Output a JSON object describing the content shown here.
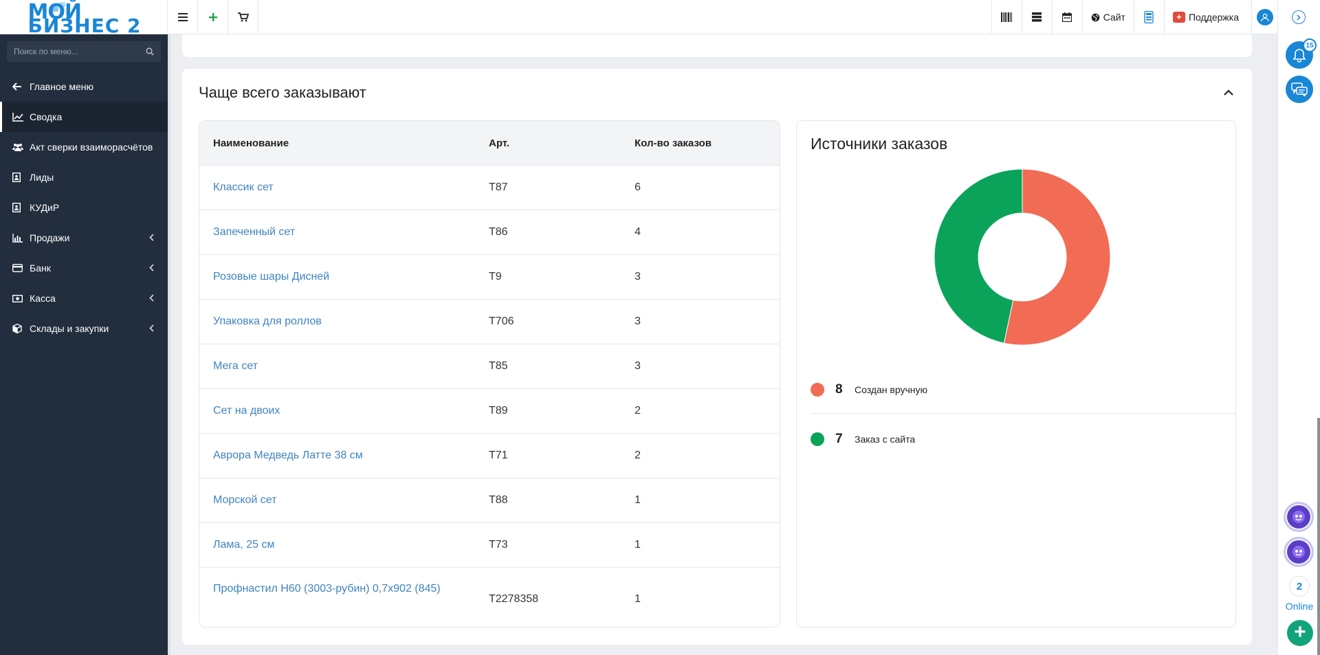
{
  "header": {
    "logo_line1": "МОЙ",
    "logo_line2": "БИЗНЕС 2",
    "site_label": "Сайт",
    "support_label": "Поддержка"
  },
  "sidebar": {
    "search_placeholder": "Поиск по меню...",
    "items": [
      {
        "label": "Главное меню",
        "icon": "arrow-left-icon",
        "active": false,
        "has_submenu": false
      },
      {
        "label": "Сводка",
        "icon": "chart-line-icon",
        "active": true,
        "has_submenu": false
      },
      {
        "label": "Акт сверки взаиморасчётов",
        "icon": "users-icon",
        "active": false,
        "has_submenu": false
      },
      {
        "label": "Лиды",
        "icon": "contact-card-icon",
        "active": false,
        "has_submenu": false
      },
      {
        "label": "КУДиР",
        "icon": "contact-card-icon",
        "active": false,
        "has_submenu": false
      },
      {
        "label": "Продажи",
        "icon": "bar-chart-icon",
        "active": false,
        "has_submenu": true
      },
      {
        "label": "Банк",
        "icon": "credit-card-icon",
        "active": false,
        "has_submenu": true
      },
      {
        "label": "Касса",
        "icon": "money-icon",
        "active": false,
        "has_submenu": true
      },
      {
        "label": "Склады и закупки",
        "icon": "box-icon",
        "active": false,
        "has_submenu": true
      }
    ]
  },
  "section": {
    "title": "Чаще всего заказывают"
  },
  "table": {
    "columns": [
      "Наименование",
      "Арт.",
      "Кол-во заказов"
    ],
    "rows": [
      {
        "name": "Классик сет",
        "sku": "T87",
        "orders": "6"
      },
      {
        "name": "Запеченный сет",
        "sku": "T86",
        "orders": "4"
      },
      {
        "name": "Розовые шары Дисней",
        "sku": "T9",
        "orders": "3"
      },
      {
        "name": "Упаковка для роллов",
        "sku": "T706",
        "orders": "3"
      },
      {
        "name": "Мега сет",
        "sku": "T85",
        "orders": "3"
      },
      {
        "name": "Сет на двоих",
        "sku": "T89",
        "orders": "2"
      },
      {
        "name": "Аврора Медведь Латте 38 см",
        "sku": "T71",
        "orders": "2"
      },
      {
        "name": "Морской сет",
        "sku": "T88",
        "orders": "1"
      },
      {
        "name": "Лама, 25 см",
        "sku": "T73",
        "orders": "1"
      },
      {
        "name": "Профнастил Н60 (3003-рубин) 0,7х902 (845)",
        "sku": "T2278358",
        "orders": "1"
      }
    ]
  },
  "sources": {
    "title": "Источники заказов"
  },
  "chart_data": {
    "type": "pie",
    "title": "Источники заказов",
    "series": [
      {
        "name": "Создан вручную",
        "value": 8,
        "color": "#f26b55"
      },
      {
        "name": "Заказ с сайта",
        "value": 7,
        "color": "#0ba35a"
      }
    ],
    "donut": true,
    "legend_position": "bottom"
  },
  "rail": {
    "notifications_count": "15",
    "online_count": "2",
    "online_label": "Online",
    "plus_label": "+"
  },
  "colors": {
    "sidebar_bg": "#222d3d",
    "accent": "#1a86d6",
    "link": "#3e84c2",
    "success": "#12a37a"
  }
}
